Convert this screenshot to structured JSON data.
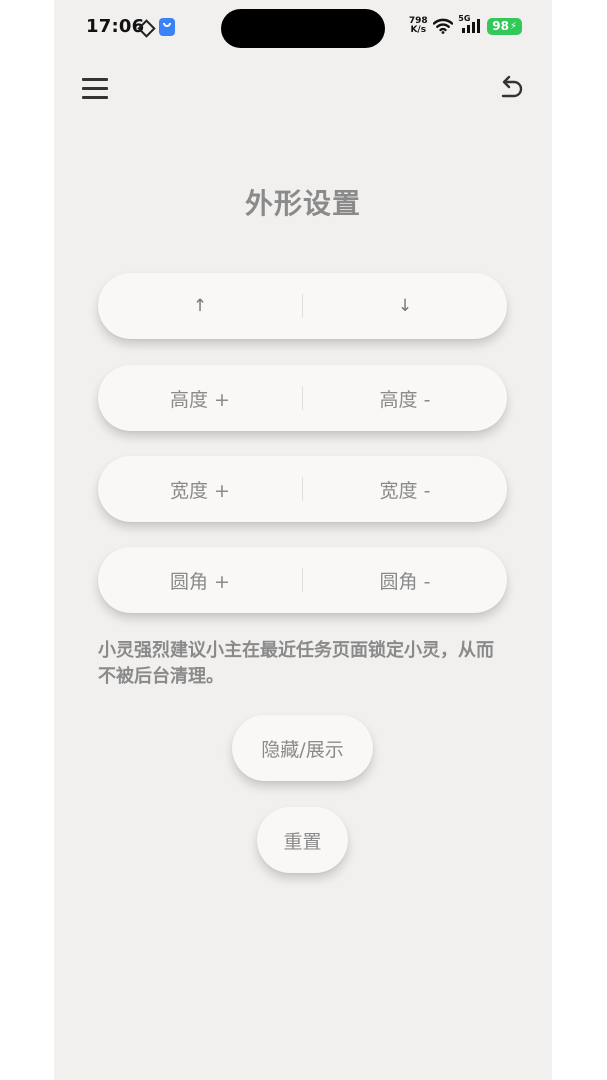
{
  "status_bar": {
    "time": "17:06",
    "net_speed_value": "798",
    "net_speed_unit": "K/s",
    "signal_label": "5G",
    "battery": "98"
  },
  "header": {
    "menu_icon": "hamburger-menu-icon",
    "undo_icon": "undo-icon"
  },
  "page_title": "外形设置",
  "controls": [
    {
      "left": "↑",
      "right": "↓"
    },
    {
      "left": "高度 +",
      "right": "高度 -"
    },
    {
      "left": "宽度 +",
      "right": "宽度 -"
    },
    {
      "left": "圆角 +",
      "right": "圆角 -"
    }
  ],
  "note": "小灵强烈建议小主在最近任务页面锁定小灵，从而不被后台清理。",
  "actions": {
    "toggle_label": "隐藏/展示",
    "reset_label": "重置"
  },
  "colors": {
    "background": "#f1f0ef",
    "button": "#f9f8f7",
    "text_muted": "#8a8a8a",
    "battery": "#34c759",
    "app_icon": "#3b82f6"
  }
}
